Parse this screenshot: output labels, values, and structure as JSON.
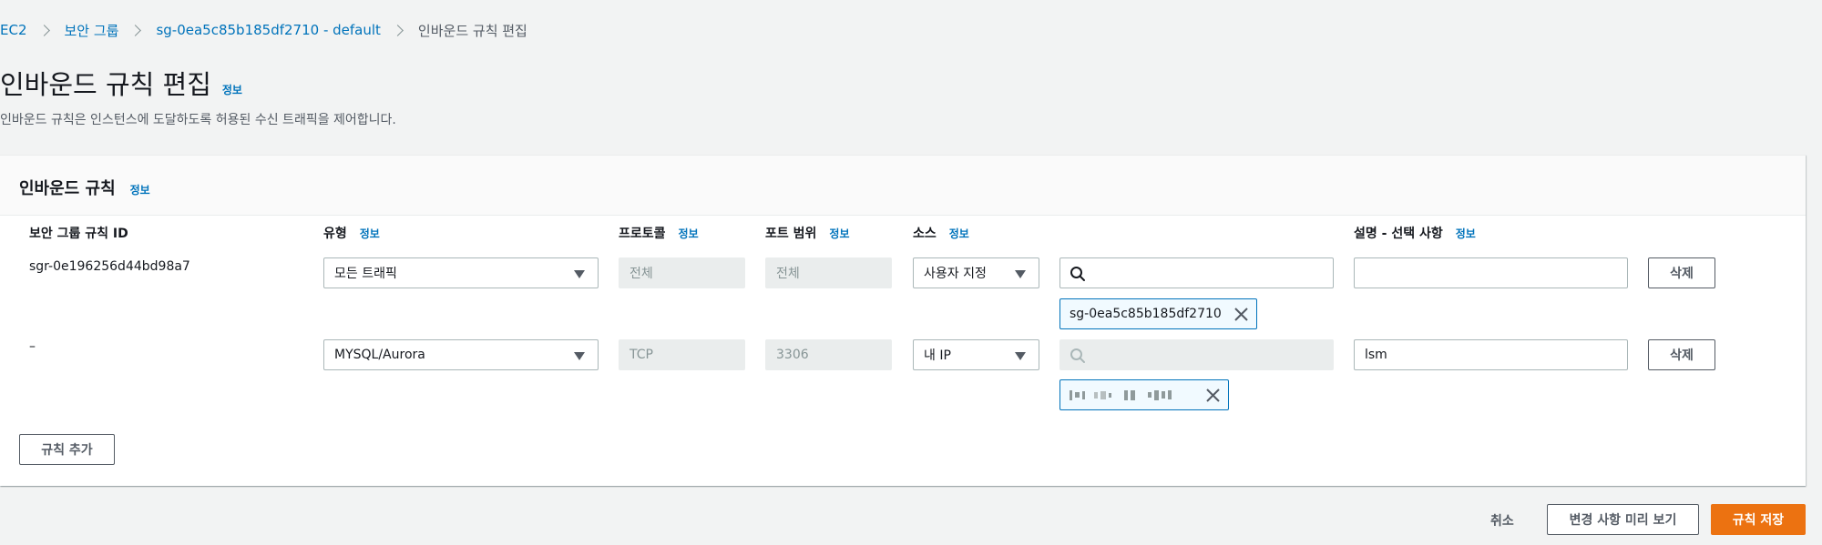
{
  "breadcrumb": {
    "items": [
      "EC2",
      "보안 그룹",
      "sg-0ea5c85b185df2710 - default"
    ],
    "current": "인바운드 규칙 편집"
  },
  "page": {
    "title": "인바운드 규칙 편집",
    "info": "정보",
    "description": "인바운드 규칙은 인스턴스에 도달하도록 허용된 수신 트래픽을 제어합니다."
  },
  "panel": {
    "title": "인바운드 규칙",
    "info": "정보"
  },
  "columns": {
    "rule_id": "보안 그룹 규칙 ID",
    "type": "유형",
    "protocol": "프로토콜",
    "port": "포트 범위",
    "source": "소스",
    "description": "설명 - 선택 사항",
    "info": "정보"
  },
  "rules": [
    {
      "id": "sgr-0e196256d44bd98a7",
      "type": "모든 트래픽",
      "protocol": "전체",
      "port": "전체",
      "source_type": "사용자 지정",
      "search_value": "",
      "token": "sg-0ea5c85b185df2710",
      "description": "",
      "delete": "삭제"
    },
    {
      "id": "–",
      "type": "MYSQL/Aurora",
      "protocol": "TCP",
      "port": "3306",
      "source_type": "내 IP",
      "search_value": "",
      "token": "[redacted IP]",
      "description": "lsm",
      "delete": "삭제"
    }
  ],
  "add_rule": "규칙 추가",
  "footer": {
    "cancel": "취소",
    "preview": "변경 사항 미리 보기",
    "save": "규칙 저장"
  },
  "colors": {
    "link": "#0073bb",
    "primary": "#ec7211",
    "token_border": "#0073bb"
  }
}
